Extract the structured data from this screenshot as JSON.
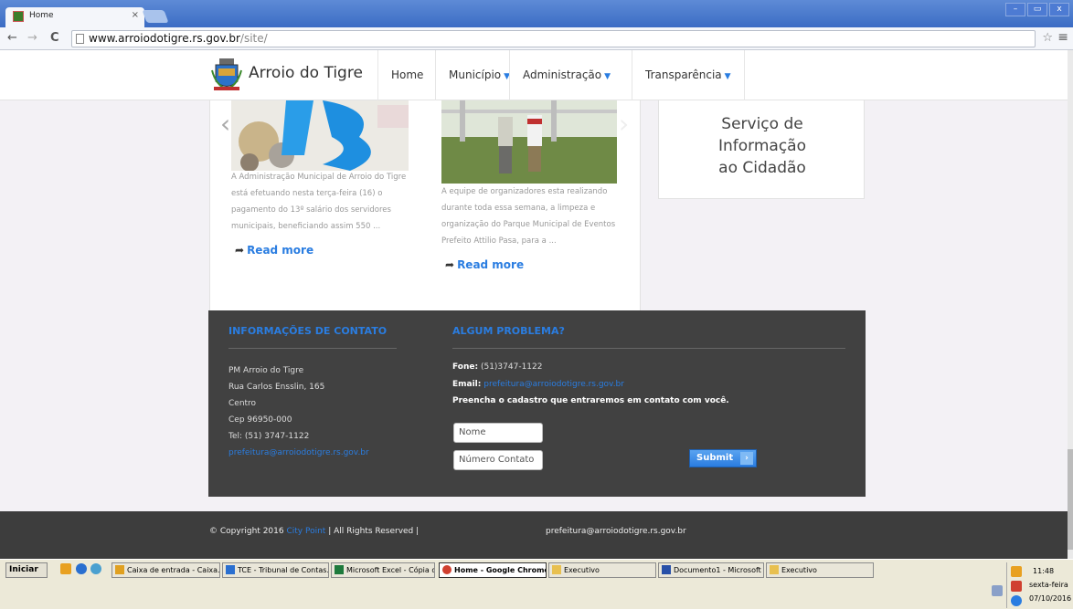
{
  "browser": {
    "tab_title": "Home",
    "tab_close": "×",
    "url_host": "www.arroiodotigre.rs.gov.br",
    "url_path": "/site/",
    "back": "←",
    "forward": "→",
    "reload": "C",
    "star": "☆",
    "menu": "≡",
    "window_buttons": [
      "–",
      "▭",
      "x"
    ]
  },
  "site": {
    "brand": "Arroio do Tigre",
    "nav": [
      {
        "label": "Home",
        "caret": ""
      },
      {
        "label": "Município",
        "caret": "▼"
      },
      {
        "label": "Administração",
        "caret": "▼"
      },
      {
        "label": "Transparência",
        "caret": "▼"
      }
    ]
  },
  "news": [
    {
      "excerpt": [
        "A Administração Municipal de Arroio do Tigre",
        "está efetuando nesta terça-feira (16) o",
        "pagamento do 13º salário dos servidores",
        "municipais, beneficiando assim 550 ..."
      ],
      "read_more": "Read more"
    },
    {
      "excerpt": [
        "A equipe de organizadores esta realizando",
        "durante toda essa semana, a limpeza e",
        "organização do Parque Municipal de Eventos",
        "Prefeito Attilio Pasa, para a ..."
      ],
      "read_more": "Read more"
    }
  ],
  "service": {
    "lines": [
      "Serviço de",
      "Informação",
      "ao Cidadão"
    ]
  },
  "contact": {
    "heading_left": "INFORMAÇÕES DE CONTATO",
    "heading_right": "ALGUM PROBLEMA?",
    "address": [
      "PM Arroio do Tigre",
      "Rua Carlos Ensslin, 165",
      "Centro",
      "Cep 96950-000",
      "Tel: (51) 3747-1122"
    ],
    "email_link": "prefeitura@arroiodotigre.rs.gov.br",
    "fone_label": "Fone:",
    "fone_value": "(51)3747-1122",
    "email_label": "Email:",
    "email_value": "prefeitura@arroiodotigre.rs.gov.br",
    "cta": "Preencha o cadastro que entraremos em contato com você.",
    "name_placeholder": "Nome",
    "phone_placeholder": "Número Contato",
    "submit": "Submit",
    "submit_arrow": "›"
  },
  "footer": {
    "copyright_pre": "© Copyright 2016",
    "company": "City Point",
    "copyright_post": "| All Rights Reserved |",
    "email": "prefeitura@arroiodotigre.rs.gov.br"
  },
  "taskbar": {
    "start": "Iniciar",
    "tasks": [
      {
        "label": "Caixa de entrada - Caixa...",
        "icon_color": "#e0a020",
        "active": false
      },
      {
        "label": "TCE - Tribunal de Contas...",
        "icon_color": "#2a6fd0",
        "active": false
      },
      {
        "label": "Microsoft Excel - Cópia d...",
        "icon_color": "#1e7a3c",
        "active": false
      },
      {
        "label": "Home - Google Chrome",
        "icon_color": "#d04030",
        "active": true
      },
      {
        "label": "Executivo",
        "icon_color": "#e8c050",
        "active": false
      },
      {
        "label": "Documento1 - Microsoft ...",
        "icon_color": "#2850a8",
        "active": false
      },
      {
        "label": "Executivo",
        "icon_color": "#e8c050",
        "active": false
      }
    ],
    "time": "11:48",
    "day": "sexta-feira",
    "date": "07/10/2016"
  }
}
